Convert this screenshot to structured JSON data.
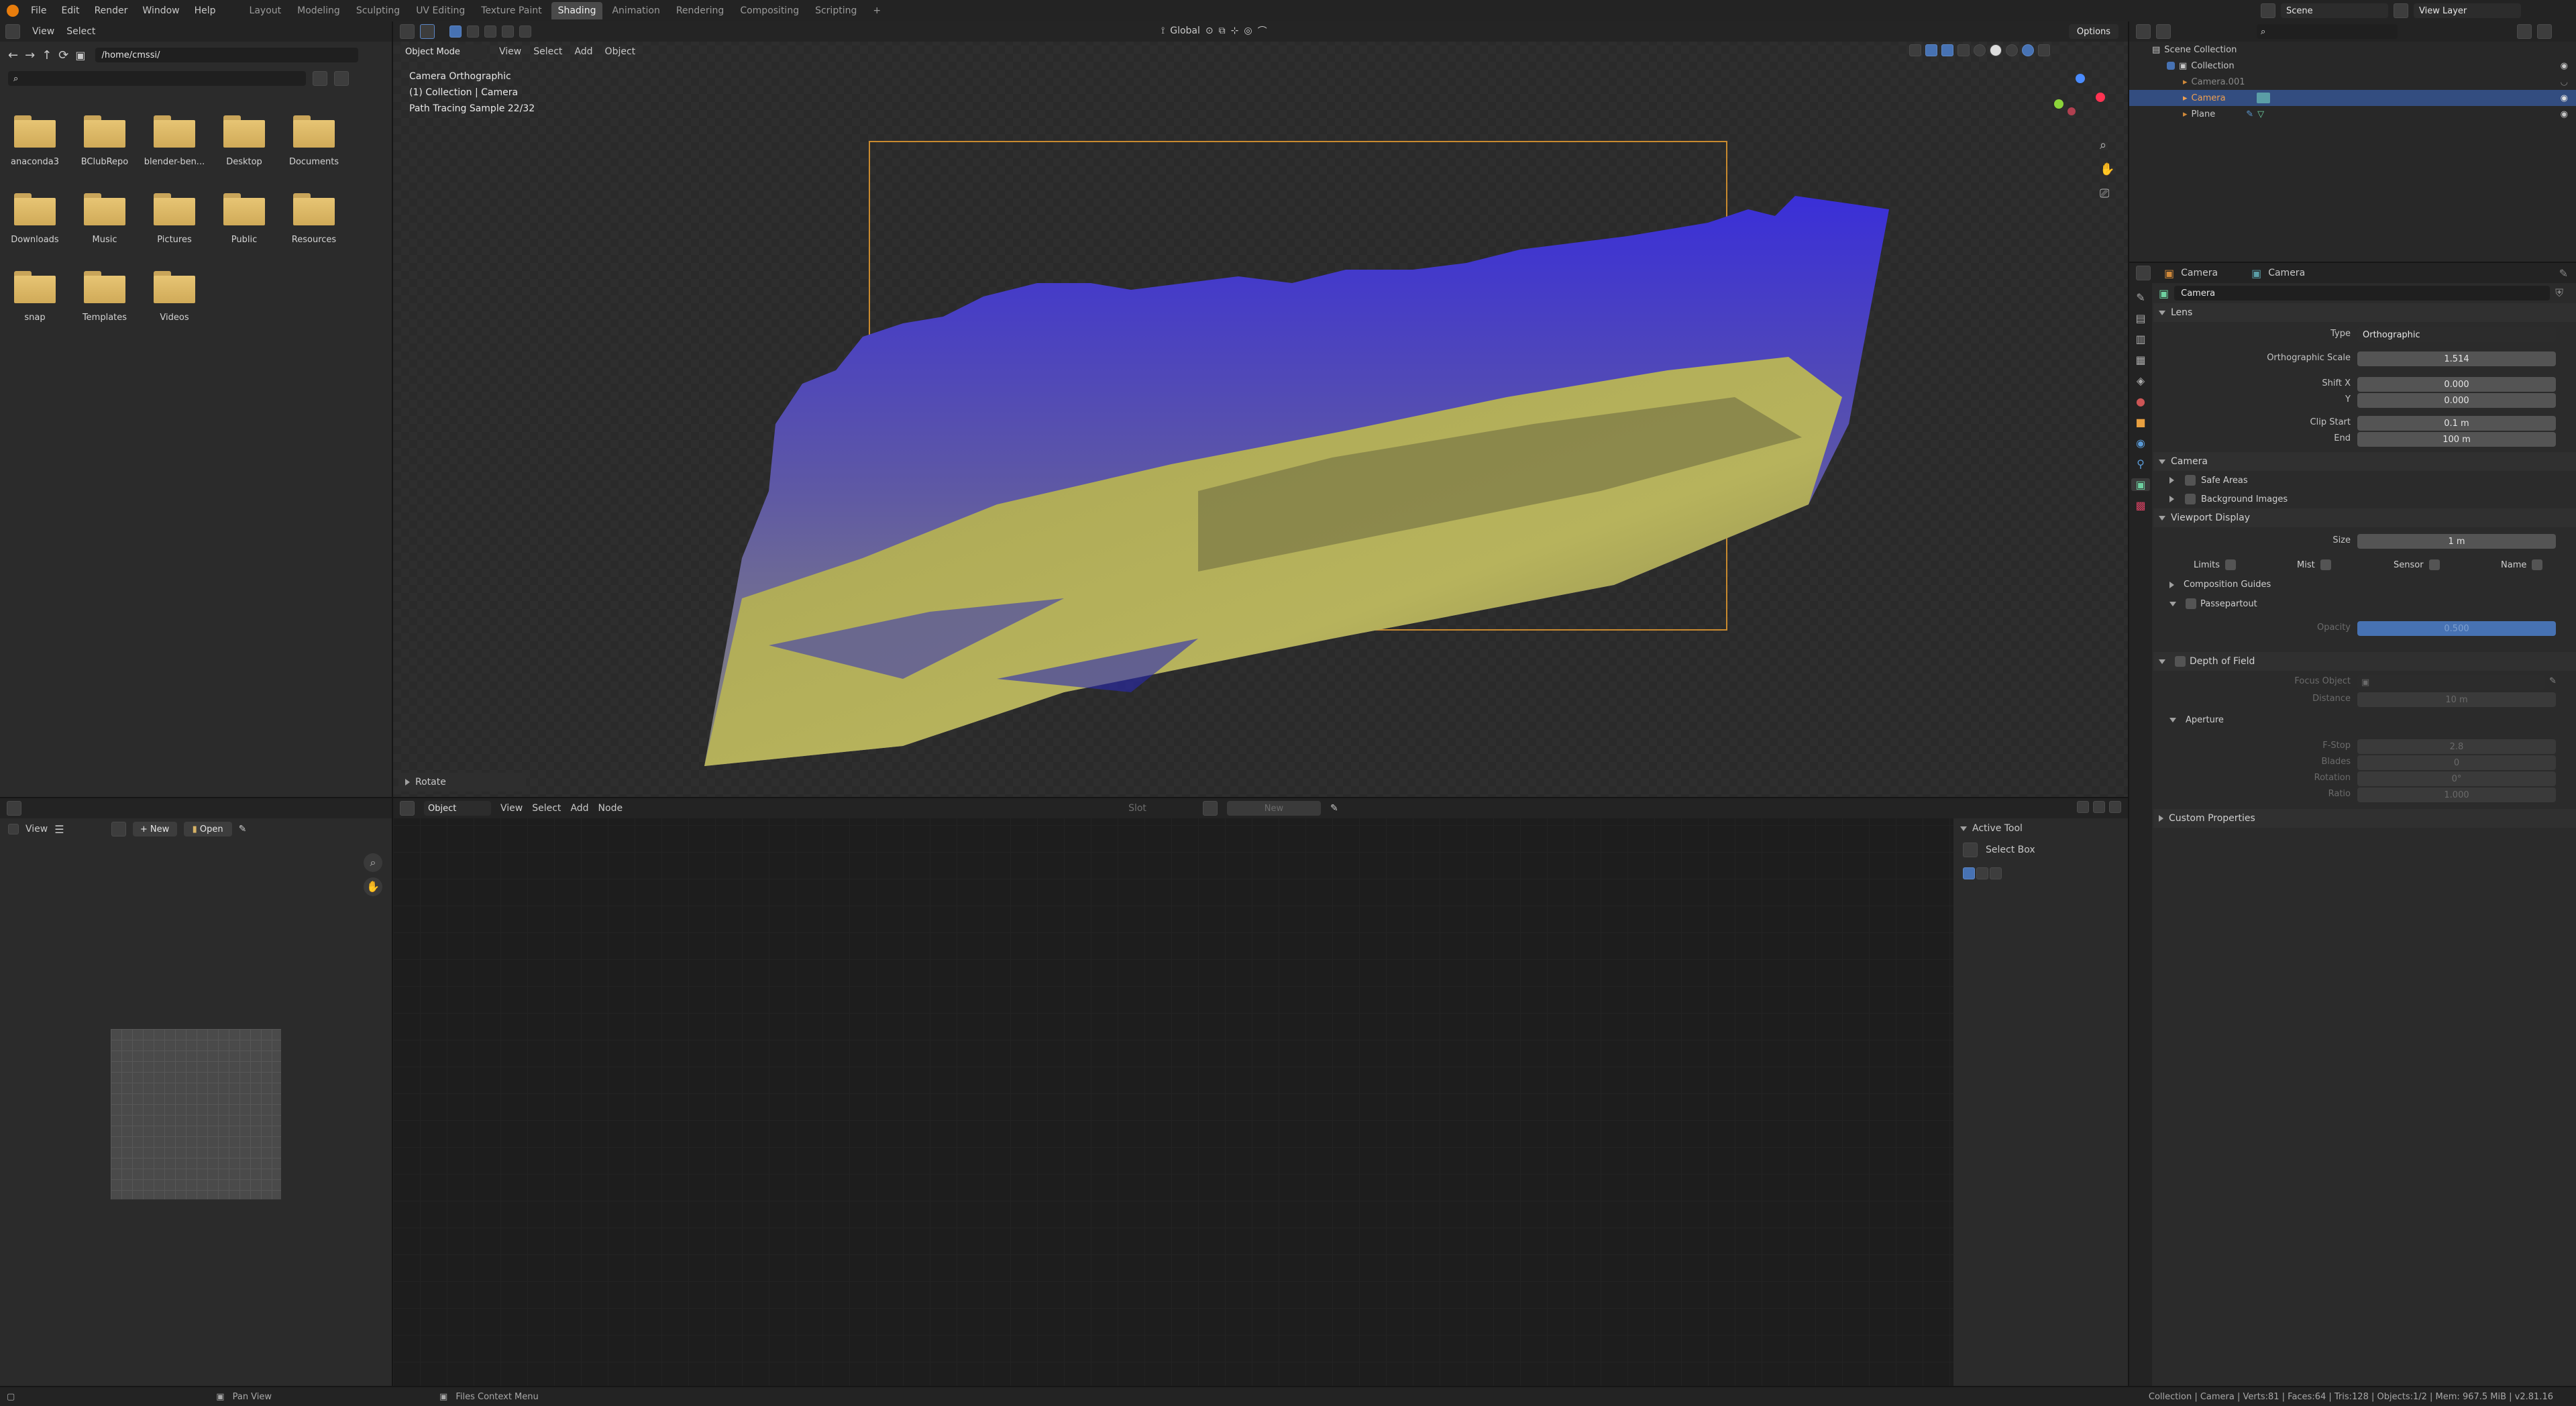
{
  "menubar": {
    "items": [
      "File",
      "Edit",
      "Render",
      "Window",
      "Help"
    ],
    "workspaces": [
      "Layout",
      "Modeling",
      "Sculpting",
      "UV Editing",
      "Texture Paint",
      "Shading",
      "Animation",
      "Rendering",
      "Compositing",
      "Scripting"
    ],
    "add_tab": "+",
    "scene": "Scene",
    "view_layer": "View Layer"
  },
  "filebrowser": {
    "menu": [
      "View",
      "Select"
    ],
    "path": "/home/cmssi/",
    "folders": [
      "anaconda3",
      "BClubRepo",
      "blender-ben...",
      "Desktop",
      "Documents",
      "Downloads",
      "Music",
      "Pictures",
      "Public",
      "Resources",
      "snap",
      "Templates",
      "Videos"
    ]
  },
  "viewport": {
    "mode": "Object Mode",
    "menu": [
      "View",
      "Select",
      "Add",
      "Object"
    ],
    "orientation": "Global",
    "options": "Options",
    "overlay_lines": [
      "Camera Orthographic",
      "(1) Collection | Camera",
      "Path Tracing Sample 22/32"
    ],
    "last_op": "Rotate"
  },
  "outliner": {
    "root": "Scene Collection",
    "items": [
      "Collection",
      "Camera.001",
      "Camera",
      "Plane"
    ]
  },
  "properties": {
    "crumb1": "Camera",
    "crumb2": "Camera",
    "datablock": "Camera",
    "lens": {
      "title": "Lens",
      "type_label": "Type",
      "type_value": "Orthographic",
      "ortho_label": "Orthographic Scale",
      "ortho_value": "1.514",
      "shiftx_label": "Shift X",
      "shiftx_value": "0.000",
      "shifty_label": "Y",
      "shifty_value": "0.000",
      "clipstart_label": "Clip Start",
      "clipstart_value": "0.1 m",
      "clipend_label": "End",
      "clipend_value": "100 m"
    },
    "camera": {
      "title": "Camera",
      "safe_areas": "Safe Areas",
      "bg_images": "Background Images"
    },
    "viewport_display": {
      "title": "Viewport Display",
      "size_label": "Size",
      "size_value": "1 m",
      "limits": "Limits",
      "mist": "Mist",
      "sensor": "Sensor",
      "name": "Name",
      "comp_guides": "Composition Guides",
      "passepartout": "Passepartout",
      "opacity_label": "Opacity",
      "opacity_value": "0.500"
    },
    "dof": {
      "title": "Depth of Field",
      "focus_label": "Focus Object",
      "distance_label": "Distance",
      "distance_value": "10 m",
      "aperture": "Aperture",
      "fstop_label": "F-Stop",
      "fstop_value": "2.8",
      "blades_label": "Blades",
      "blades_value": "0",
      "rotation_label": "Rotation",
      "rotation_value": "0°",
      "ratio_label": "Ratio",
      "ratio_value": "1.000"
    },
    "custom": "Custom Properties"
  },
  "image_editor": {
    "menu": "View",
    "new": "New",
    "open": "Open"
  },
  "node_editor": {
    "object": "Object",
    "menu": [
      "View",
      "Select",
      "Add",
      "Node"
    ],
    "slot": "Slot",
    "new": "New",
    "active_tool_title": "Active Tool",
    "select_box": "Select Box"
  },
  "statusbar": {
    "left": "Pan View",
    "middle": "Files Context Menu",
    "right": "Collection | Camera | Verts:81 | Faces:64 | Tris:128 | Objects:1/2 | Mem: 967.5 MiB | v2.81.16"
  }
}
